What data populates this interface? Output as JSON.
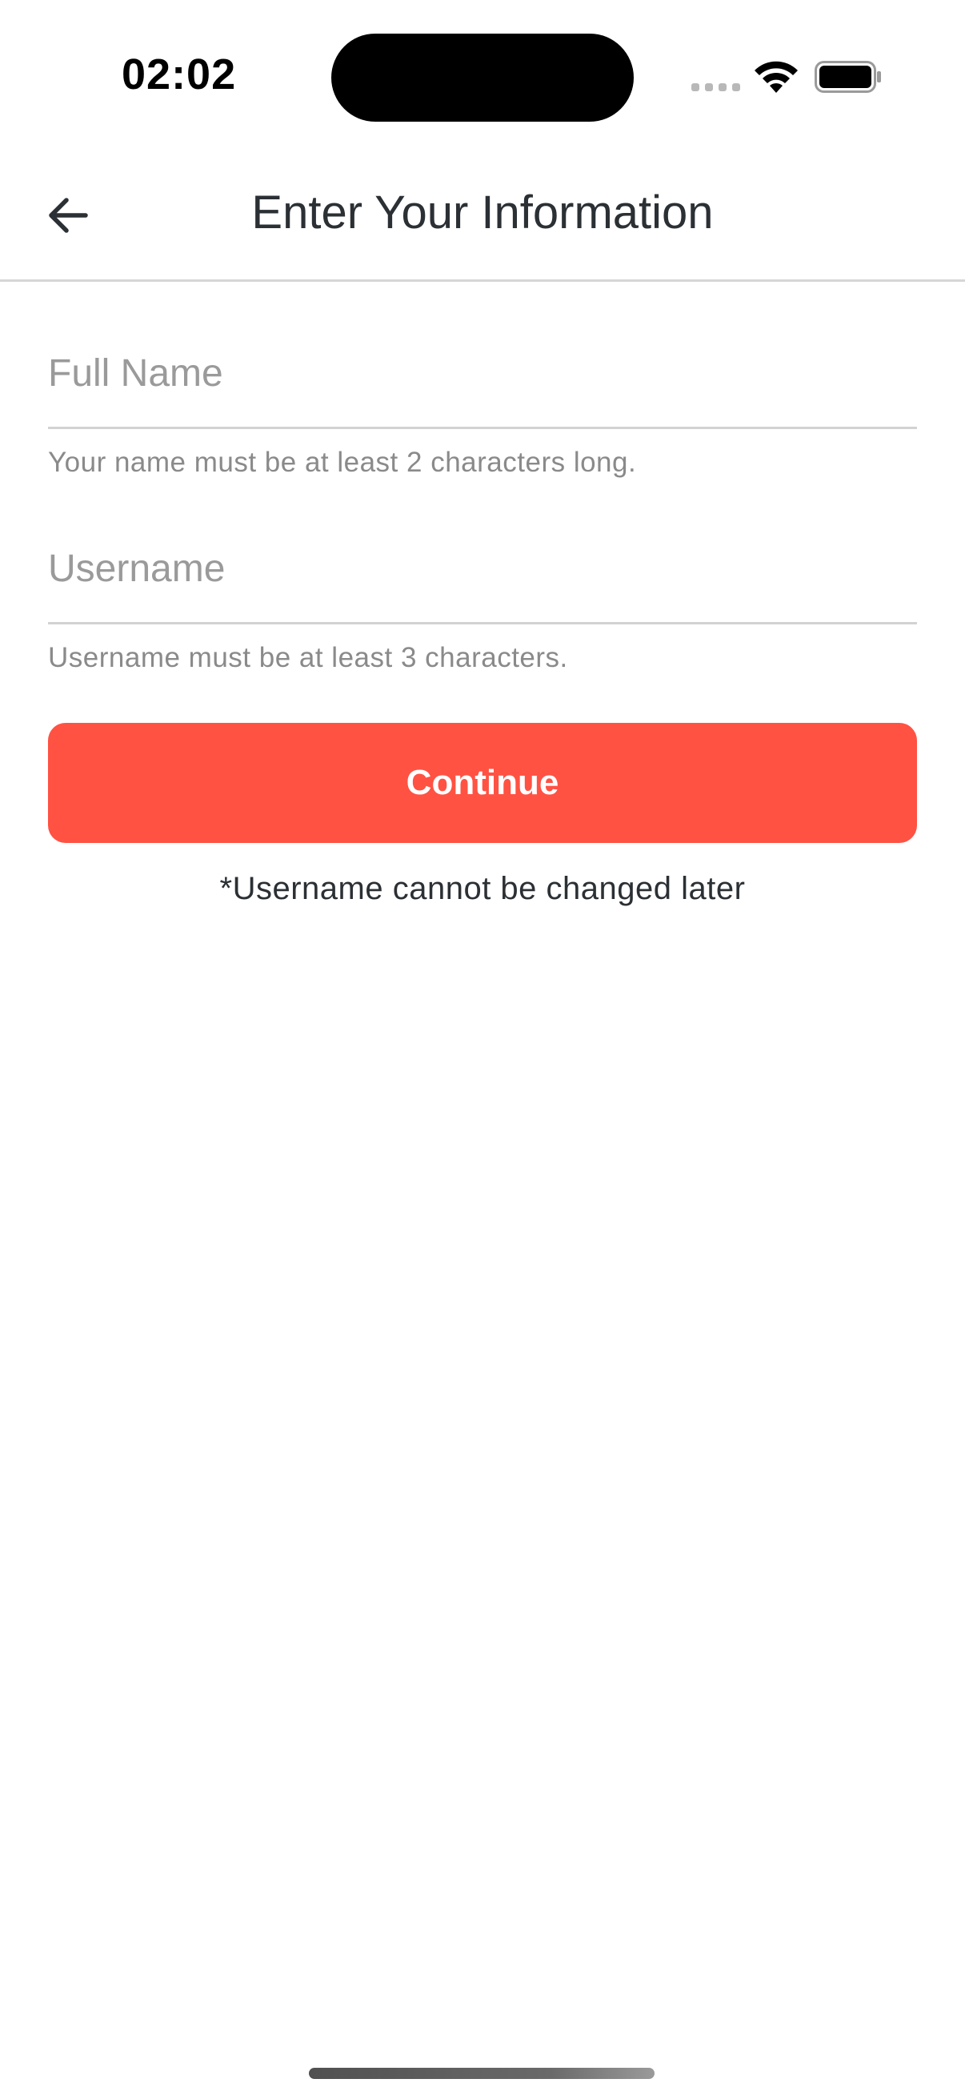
{
  "status_bar": {
    "time": "02:02",
    "icons": [
      "cellular-signal-icon",
      "wifi-icon",
      "battery-icon"
    ]
  },
  "header": {
    "back_icon": "arrow-left-icon",
    "title": "Enter Your Information"
  },
  "form": {
    "full_name": {
      "value": "",
      "placeholder": "Full Name",
      "hint": "Your name must be at least 2 characters long."
    },
    "username": {
      "value": "",
      "placeholder": "Username",
      "hint": "Username must be at least 3 characters."
    },
    "continue_label": "Continue",
    "disclaimer": "*Username cannot be changed later"
  },
  "colors": {
    "accent": "#ff5243",
    "title_text": "#2b3035",
    "hint_text": "#8a8a8a",
    "divider": "#d6d6d6"
  }
}
